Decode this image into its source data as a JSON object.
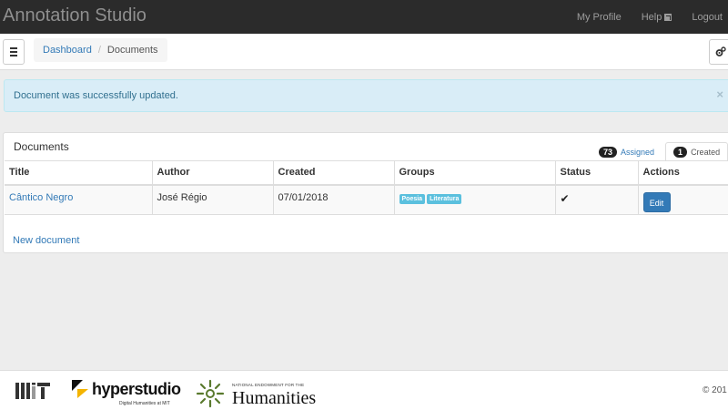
{
  "app": {
    "title": "Annotation Studio"
  },
  "nav": {
    "profile": "My Profile",
    "help": "Help",
    "logout": "Logout"
  },
  "breadcrumb": {
    "dashboard": "Dashboard",
    "current": "Documents"
  },
  "alert": {
    "message": "Document was successfully updated.",
    "close": "×"
  },
  "panel": {
    "title": "Documents",
    "tabs": {
      "assigned": {
        "count": "73",
        "label": "Assigned"
      },
      "created": {
        "count": "1",
        "label": "Created"
      }
    }
  },
  "table": {
    "headers": [
      "Title",
      "Author",
      "Created",
      "Groups",
      "Status",
      "Actions"
    ],
    "rows": [
      {
        "title": "Cântico Negro",
        "author": "José Régio",
        "created": "07/01/2018",
        "groups": [
          "Poesia",
          "Literatura"
        ],
        "status_icon": "check-icon",
        "action": "Edit"
      }
    ]
  },
  "new_document": "New document",
  "footer": {
    "hyper_name": "hyperstudio",
    "hyper_sub": "Digital Humanities at MIT",
    "neh_top": "NATIONAL ENDOWMENT FOR THE",
    "neh_name": "Humanities",
    "copyright": "© 201"
  },
  "colors": {
    "navbar": "#2b2b2b",
    "link": "#337ab7",
    "alert_bg": "#d9edf7",
    "label_info": "#5bc0de",
    "primary_button": "#337ab7",
    "neh_green": "#5a7a2e"
  }
}
